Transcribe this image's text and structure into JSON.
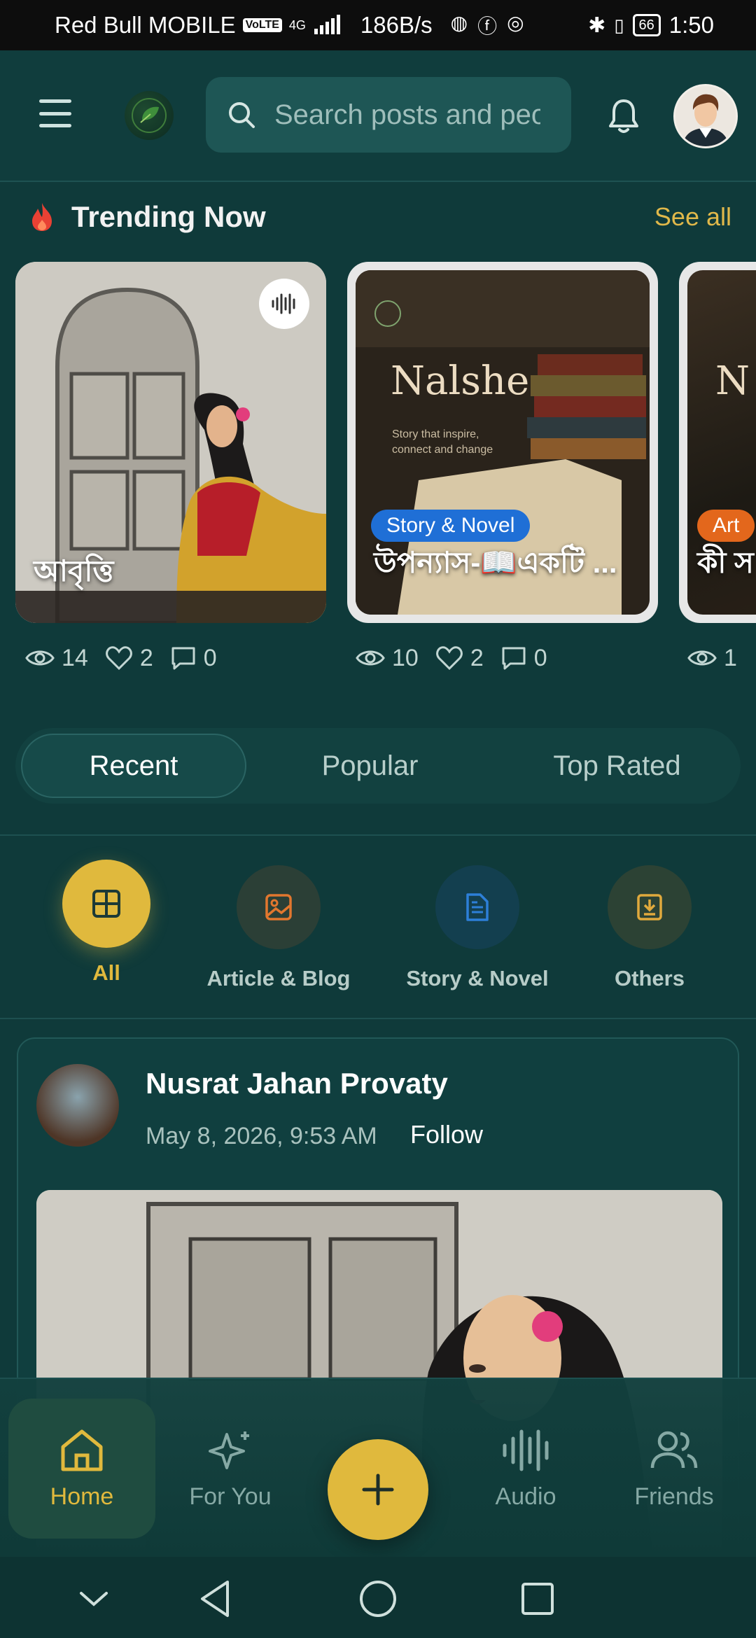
{
  "status_bar": {
    "carrier": "Red Bull MOBILE",
    "volte": "VoLTE",
    "network": "4G",
    "speed": "186B/s",
    "battery": "66",
    "time": "1:50"
  },
  "header": {
    "search_placeholder": "Search posts and people",
    "icons": [
      "menu-icon",
      "logo",
      "search-icon",
      "bell-icon",
      "profile-avatar"
    ]
  },
  "trending": {
    "title": "Trending Now",
    "see_all": "See all",
    "cards": [
      {
        "title": "আবৃত্তি",
        "badge": "",
        "has_audio": true,
        "views": "14",
        "likes": "2",
        "comments": "0"
      },
      {
        "title": "উপন্যাস-📖একটি ...",
        "badge": "Story & Novel",
        "brand": "Nalshe",
        "tagline": "Story that inspire, connect and change",
        "views": "10",
        "likes": "2",
        "comments": "0"
      },
      {
        "title": "কী স",
        "badge": "Art",
        "brand": "N",
        "views": "1"
      }
    ]
  },
  "tabs": [
    {
      "label": "Recent",
      "active": true
    },
    {
      "label": "Popular",
      "active": false
    },
    {
      "label": "Top Rated",
      "active": false
    }
  ],
  "categories": [
    {
      "label": "All",
      "icon": "grid-icon",
      "active": true,
      "color": "#e0b93d"
    },
    {
      "label": "Article & Blog",
      "icon": "image-icon",
      "active": false,
      "color": "#e2772e"
    },
    {
      "label": "Story & Novel",
      "icon": "document-icon",
      "active": false,
      "color": "#2d7fd8"
    },
    {
      "label": "Others",
      "icon": "download-icon",
      "active": false,
      "color": "#e0a93d"
    }
  ],
  "post": {
    "author": "Nusrat Jahan Provaty",
    "date": "May 8, 2026, 9:53 AM",
    "follow": "Follow"
  },
  "bottom_nav": [
    {
      "label": "Home",
      "icon": "home-icon",
      "active": true
    },
    {
      "label": "For You",
      "icon": "sparkle-icon",
      "active": false
    },
    {
      "label": "Audio",
      "icon": "audio-wave-icon",
      "active": false
    },
    {
      "label": "Friends",
      "icon": "friends-icon",
      "active": false
    }
  ],
  "colors": {
    "background": "#0f3a3a",
    "accent": "#e0b93d",
    "badge_blue": "#1f6fd6",
    "badge_orange": "#e3671c"
  }
}
